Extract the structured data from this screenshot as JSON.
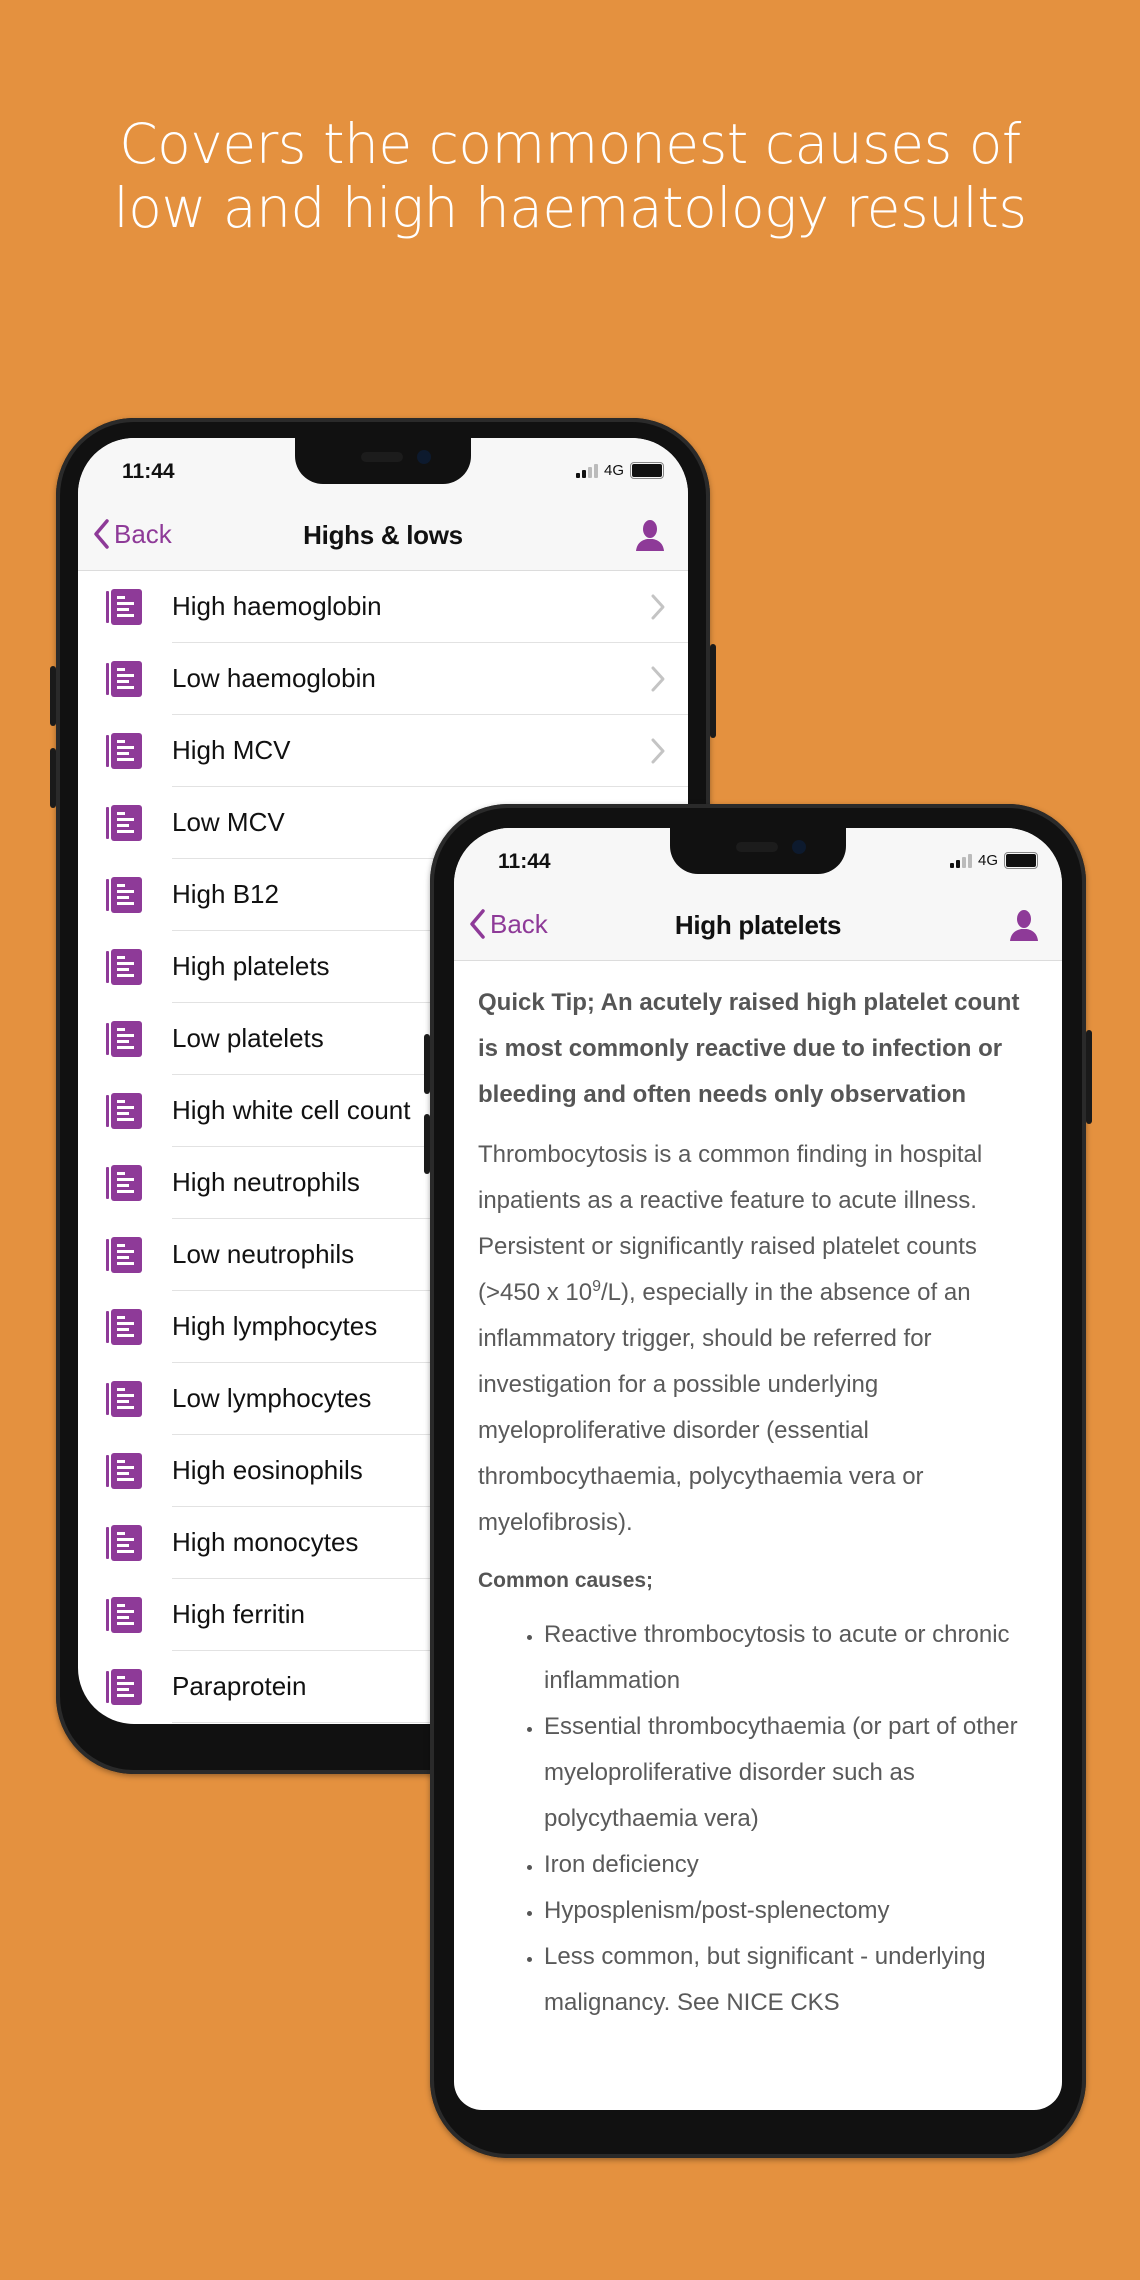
{
  "headline": {
    "line1": "Covers the commonest causes of",
    "line2": "low and high haematology results"
  },
  "colors": {
    "background": "#E4913F",
    "accent": "#8E3A98",
    "text": "#111111",
    "body_text": "#5a5a5a"
  },
  "phone_back": {
    "status": {
      "time": "11:44",
      "network": "4G",
      "signal_icon": "signal-bars-icon",
      "battery_icon": "battery-icon"
    },
    "nav": {
      "back_label": "Back",
      "title": "Highs & lows",
      "back_icon": "chevron-left-icon",
      "profile_icon": "user-icon"
    },
    "items": [
      {
        "label": "High haemoglobin",
        "icon": "article-icon",
        "chevron": true
      },
      {
        "label": "Low haemoglobin",
        "icon": "article-icon",
        "chevron": true
      },
      {
        "label": "High MCV",
        "icon": "article-icon",
        "chevron": true
      },
      {
        "label": "Low MCV",
        "icon": "article-icon",
        "chevron": false
      },
      {
        "label": "High B12",
        "icon": "article-icon",
        "chevron": false
      },
      {
        "label": "High platelets",
        "icon": "article-icon",
        "chevron": false
      },
      {
        "label": "Low platelets",
        "icon": "article-icon",
        "chevron": false
      },
      {
        "label": "High white cell count",
        "icon": "article-icon",
        "chevron": false
      },
      {
        "label": "High neutrophils",
        "icon": "article-icon",
        "chevron": false
      },
      {
        "label": "Low neutrophils",
        "icon": "article-icon",
        "chevron": false
      },
      {
        "label": "High lymphocytes",
        "icon": "article-icon",
        "chevron": false
      },
      {
        "label": "Low lymphocytes",
        "icon": "article-icon",
        "chevron": false
      },
      {
        "label": "High eosinophils",
        "icon": "article-icon",
        "chevron": false
      },
      {
        "label": "High monocytes",
        "icon": "article-icon",
        "chevron": false
      },
      {
        "label": "High ferritin",
        "icon": "article-icon",
        "chevron": false
      },
      {
        "label": "Paraprotein",
        "icon": "article-icon",
        "chevron": false
      }
    ]
  },
  "phone_front": {
    "status": {
      "time": "11:44",
      "network": "4G"
    },
    "nav": {
      "back_label": "Back",
      "title": "High platelets"
    },
    "quick_tip": "Quick Tip; An acutely raised high platelet count is most commonly reactive due to infection or bleeding and often needs only observation",
    "paragraph": {
      "before_sup": "Thrombocytosis is a common finding in hospital inpatients as a reactive feature to acute illness. Persistent or significantly raised platelet counts (>450 x 10",
      "sup": "9",
      "after_sup": "/L), especially in the absence of an inflammatory trigger, should be referred for investigation for a possible underlying myeloproliferative disorder (essential thrombocythaemia, polycythaemia vera or myelofibrosis)."
    },
    "causes_heading": "Common causes;",
    "causes": [
      "Reactive thrombocytosis to acute or chronic inflammation",
      "Essential thrombocythaemia (or part of other myeloproliferative disorder such as polycythaemia vera)",
      "Iron deficiency",
      "Hyposplenism/post-splenectomy",
      "Less common, but significant - underlying malignancy. See NICE CKS"
    ]
  }
}
